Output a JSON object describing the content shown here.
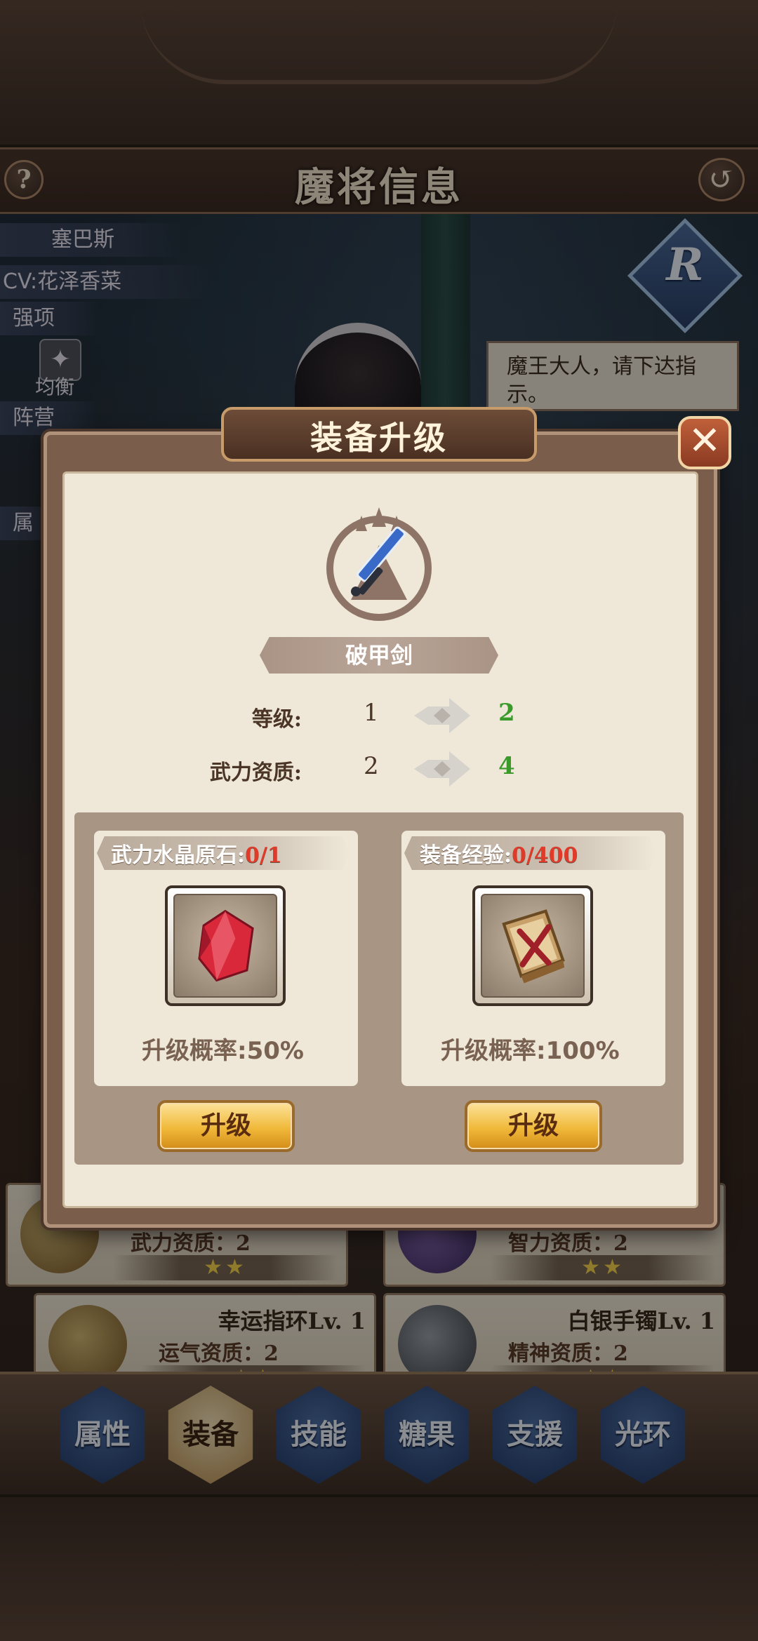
{
  "header": {
    "title": "魔将信息",
    "help_icon": "?",
    "back_icon": "↺"
  },
  "hero": {
    "name": "塞巴斯",
    "cv": "CV:花泽香菜",
    "strength_label": "强项",
    "role": "均衡",
    "faction_label": "阵营",
    "attr_label": "属",
    "rank": "R",
    "dialog": "魔王大人，请下达指示。"
  },
  "equipment_cards": [
    {
      "name": "",
      "stat": "武力资质：2",
      "stars": "★★"
    },
    {
      "name": "",
      "stat": "智力资质：2",
      "stars": "★★"
    },
    {
      "name": "幸运指环Lv. 1",
      "stat": "运气资质：2",
      "stars": "★★"
    },
    {
      "name": "白银手镯Lv. 1",
      "stat": "精神资质：2",
      "stars": "★★"
    }
  ],
  "tabs": [
    {
      "label": "属性",
      "active": false
    },
    {
      "label": "装备",
      "active": true
    },
    {
      "label": "技能",
      "active": false
    },
    {
      "label": "糖果",
      "active": false
    },
    {
      "label": "支援",
      "active": false
    },
    {
      "label": "光环",
      "active": false
    }
  ],
  "modal": {
    "title": "装备升级",
    "close_icon": "✕",
    "item_name": "破甲剑",
    "stats": [
      {
        "label": "等级:",
        "from": "1",
        "to": "2"
      },
      {
        "label": "武力资质:",
        "from": "2",
        "to": "4"
      }
    ],
    "options": [
      {
        "title": "武力水晶原石:",
        "count": "0/1",
        "item_icon": "red-crystal-icon",
        "rate": "升级概率:50%",
        "button": "升级"
      },
      {
        "title": "装备经验:",
        "count": "0/400",
        "item_icon": "experience-book-icon",
        "rate": "升级概率:100%",
        "button": "升级"
      }
    ]
  },
  "colors": {
    "upgrade_to": "#3a9a2a",
    "count_red": "#e23a2a",
    "tab_blue": "#1f3561",
    "tab_active": "#b98d4e"
  }
}
